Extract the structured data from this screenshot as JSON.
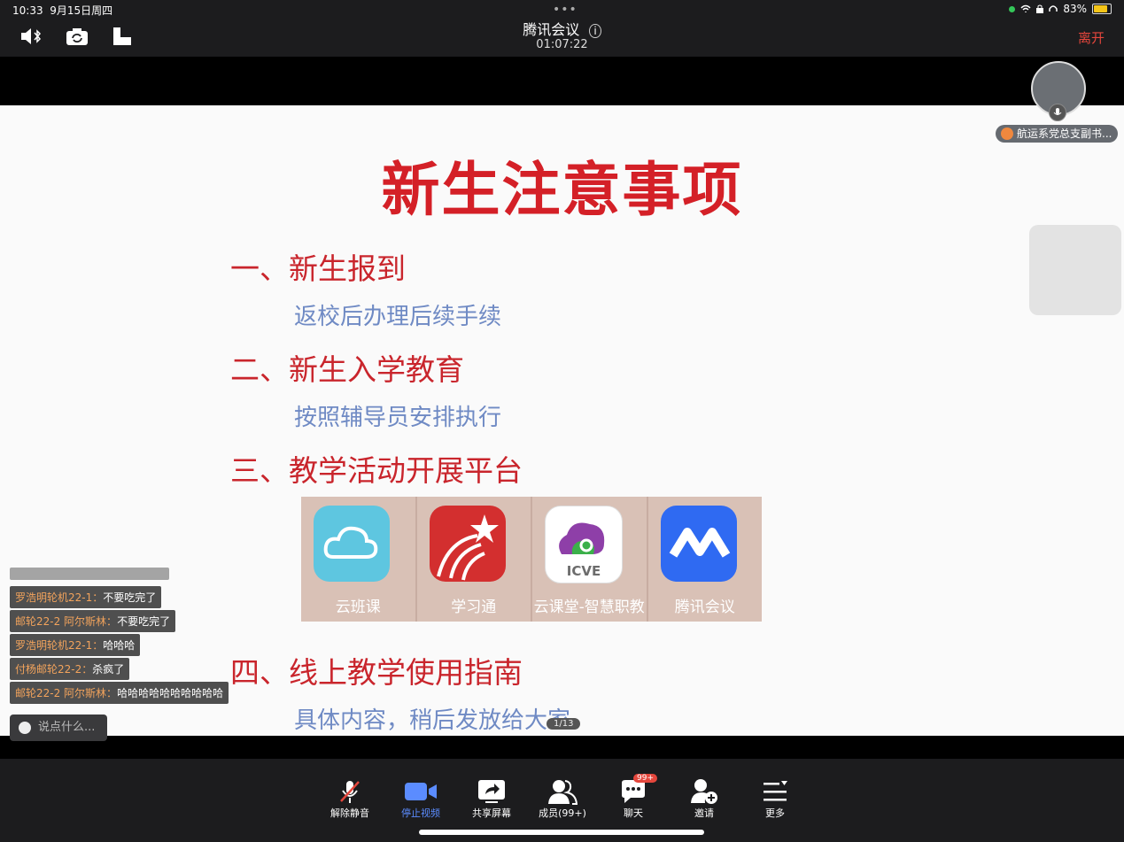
{
  "status_bar": {
    "time": "10:33",
    "date": "9月15日周四",
    "battery": "83%"
  },
  "header": {
    "title": "腾讯会议",
    "duration": "01:07:22",
    "leave_label": "离开"
  },
  "slide": {
    "title": "新生注意事项",
    "sections": [
      {
        "heading": "一、新生报到",
        "detail": "返校后办理后续手续"
      },
      {
        "heading": "二、新生入学教育",
        "detail": "按照辅导员安排执行"
      },
      {
        "heading": "三、教学活动开展平台",
        "detail": ""
      },
      {
        "heading": "四、线上教学使用指南",
        "detail": "具体内容，稍后发放给大家"
      }
    ],
    "apps": [
      {
        "label": "云班课",
        "color": "#5ec6e0"
      },
      {
        "label": "学习通",
        "color": "#d32f2f"
      },
      {
        "label": "云课堂-智慧职教",
        "color": "#8e3fa8",
        "icon_text": "ICVE"
      },
      {
        "label": "腾讯会议",
        "color": "#2f6af2"
      }
    ],
    "page_indicator": "1/13"
  },
  "participant": {
    "name": "航运系党总支副书..."
  },
  "chat": {
    "messages": [
      {
        "sender": "罗浩明轮机22-1：",
        "text": "不要吃完了"
      },
      {
        "sender": "邮轮22-2 阿尔斯林：",
        "text": "不要吃完了"
      },
      {
        "sender": "罗浩明轮机22-1：",
        "text": "哈哈哈"
      },
      {
        "sender": "付杨邮轮22-2：",
        "text": "杀疯了"
      },
      {
        "sender": "邮轮22-2 阿尔斯林：",
        "text": "哈哈哈哈哈哈哈哈哈哈"
      }
    ],
    "input_placeholder": "说点什么..."
  },
  "toolbar": {
    "items": [
      {
        "label": "解除静音",
        "icon": "mic-muted-icon"
      },
      {
        "label": "停止视频",
        "icon": "video-camera-icon"
      },
      {
        "label": "共享屏幕",
        "icon": "share-screen-icon"
      },
      {
        "label": "成员(99+)",
        "icon": "members-icon"
      },
      {
        "label": "聊天",
        "icon": "chat-icon"
      },
      {
        "label": "邀请",
        "icon": "invite-icon"
      },
      {
        "label": "更多",
        "icon": "more-icon"
      }
    ],
    "chat_badge": "99+"
  },
  "colors": {
    "accent_blue": "#5b8cff",
    "leave_red": "#e4463c",
    "slide_red": "#d42027",
    "detail_blue": "#6f8ac4"
  }
}
